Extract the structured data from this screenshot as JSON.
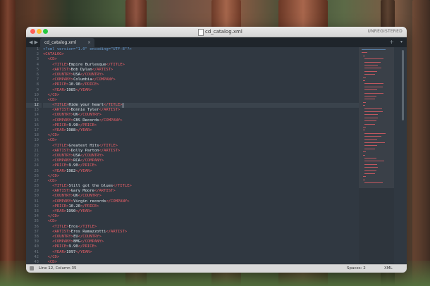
{
  "window": {
    "title": "cd_catalog.xml",
    "status_label": "UNREGISTERED"
  },
  "tabs": [
    {
      "label": "cd_catalog.xml",
      "close_glyph": "×"
    }
  ],
  "tabbar": {
    "nav_glyph": "◀ ▶",
    "plus_glyph": "+",
    "menu_glyph": "▾"
  },
  "editor": {
    "active_line": 12,
    "lines": [
      "<?xml version=\"1.0\" encoding=\"UTF-8\"?>",
      "<CATALOG>",
      "  <CD>",
      "    <TITLE>Empire Burlesque</TITLE>",
      "    <ARTIST>Bob Dylan</ARTIST>",
      "    <COUNTRY>USA</COUNTRY>",
      "    <COMPANY>Columbia</COMPANY>",
      "    <PRICE>10.90</PRICE>",
      "    <YEAR>1985</YEAR>",
      "  </CD>",
      "  <CD>",
      "    <TITLE>Hide your heart</TITLE>",
      "    <ARTIST>Bonnie Tyler</ARTIST>",
      "    <COUNTRY>UK</COUNTRY>",
      "    <COMPANY>CBS Records</COMPANY>",
      "    <PRICE>9.90</PRICE>",
      "    <YEAR>1988</YEAR>",
      "  </CD>",
      "  <CD>",
      "    <TITLE>Greatest Hits</TITLE>",
      "    <ARTIST>Dolly Parton</ARTIST>",
      "    <COUNTRY>USA</COUNTRY>",
      "    <COMPANY>RCA</COMPANY>",
      "    <PRICE>9.90</PRICE>",
      "    <YEAR>1982</YEAR>",
      "  </CD>",
      "  <CD>",
      "    <TITLE>Still got the blues</TITLE>",
      "    <ARTIST>Gary Moore</ARTIST>",
      "    <COUNTRY>UK</COUNTRY>",
      "    <COMPANY>Virgin records</COMPANY>",
      "    <PRICE>10.20</PRICE>",
      "    <YEAR>1990</YEAR>",
      "  </CD>",
      "  <CD>",
      "    <TITLE>Eros</TITLE>",
      "    <ARTIST>Eros Ramazzotti</ARTIST>",
      "    <COUNTRY>EU</COUNTRY>",
      "    <COMPANY>BMG</COMPANY>",
      "    <PRICE>9.90</PRICE>",
      "    <YEAR>1997</YEAR>",
      "  </CD>",
      "  <CD>",
      "    <TITLE>One night only</TITLE>"
    ]
  },
  "statusbar": {
    "position": "Line 12, Column 35",
    "spaces": "Spaces: 2",
    "syntax": "XML"
  },
  "colors": {
    "editor_bg": "#303841",
    "tag": "#ec5f67",
    "text": "#e0e5ea",
    "processing_instruction": "#6699cc"
  }
}
